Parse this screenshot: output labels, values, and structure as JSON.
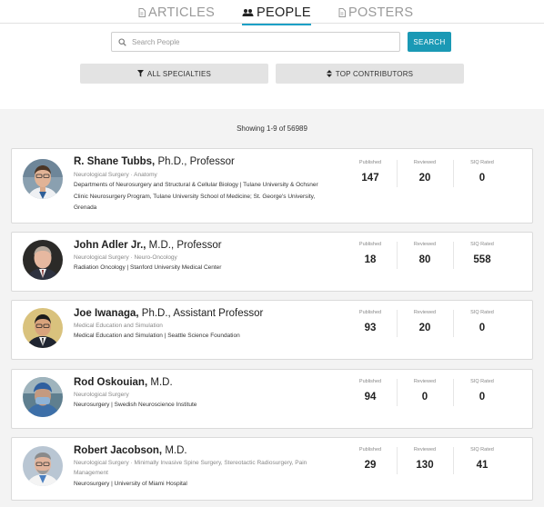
{
  "tabs": [
    {
      "label": "ARTICLES",
      "icon": "document-icon"
    },
    {
      "label": "PEOPLE",
      "icon": "people-icon"
    },
    {
      "label": "POSTERS",
      "icon": "document-icon"
    }
  ],
  "search": {
    "placeholder": "Search People",
    "button_label": "SEARCH"
  },
  "filters": {
    "specialties": "ALL SPECIALTIES",
    "sort": "TOP CONTRIBUTORS"
  },
  "results": {
    "summary": "Showing 1-9 of 56989"
  },
  "stat_labels": {
    "published": "Published",
    "reviewed": "Reviewed",
    "siq": "SIQ Rated"
  },
  "people": [
    {
      "name": "R. Shane Tubbs,",
      "title": "Ph.D., Professor",
      "specialty": "Neurological Surgery · Anatomy",
      "affiliation": "Departments of Neurosurgery and Structural & Cellular Biology | Tulane University & Ochsner Clinic Neurosurgery Program, Tulane University School of Medicine; St. George's University, Grenada",
      "published": "147",
      "reviewed": "20",
      "siq": "0"
    },
    {
      "name": "John Adler Jr.,",
      "title": "M.D., Professor",
      "specialty": "Neurological Surgery · Neuro-Oncology",
      "affiliation": "Radiation Oncology | Stanford University Medical Center",
      "published": "18",
      "reviewed": "80",
      "siq": "558"
    },
    {
      "name": "Joe Iwanaga,",
      "title": "Ph.D., Assistant Professor",
      "specialty": "Medical Education and Simulation",
      "affiliation": "Medical Education and Simulation | Seattle Science Foundation",
      "published": "93",
      "reviewed": "20",
      "siq": "0"
    },
    {
      "name": "Rod Oskouian,",
      "title": "M.D.",
      "specialty": "Neurological Surgery",
      "affiliation": "Neurosurgery | Swedish Neuroscience Institute",
      "published": "94",
      "reviewed": "0",
      "siq": "0"
    },
    {
      "name": "Robert Jacobson,",
      "title": "M.D.",
      "specialty": "Neurological Surgery · Minimally Invasive Spine Surgery, Stereotactic Radiosurgery, Pain Management",
      "affiliation": "Neurosurgery | University of Miami Hospital",
      "published": "29",
      "reviewed": "130",
      "siq": "41"
    }
  ],
  "colors": {
    "accent": "#1a99b5",
    "tab_underline": "#1aa0c6",
    "page_bg": "#f3f3f3"
  }
}
